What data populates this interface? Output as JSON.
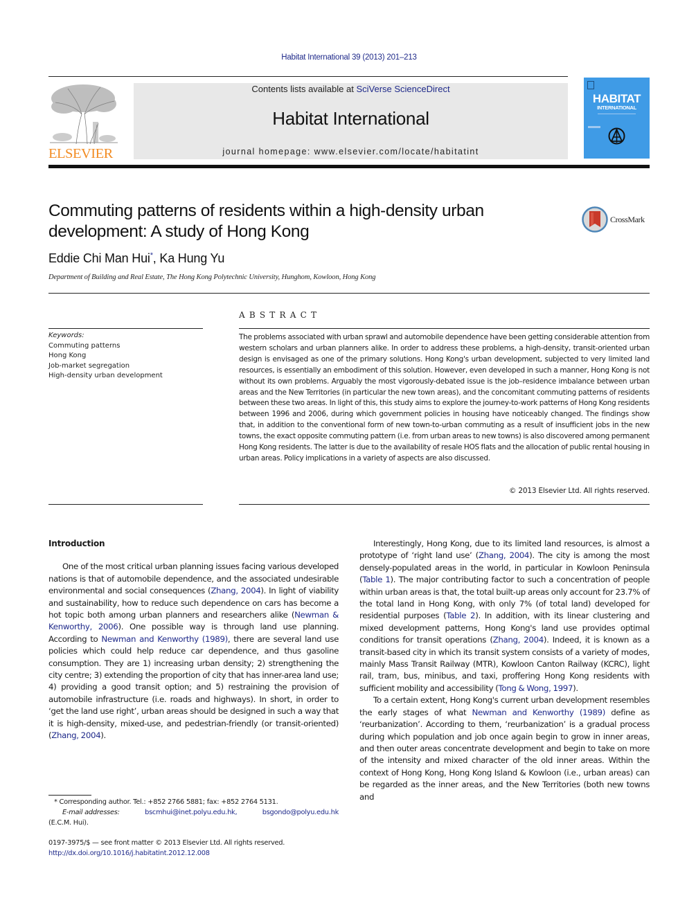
{
  "citation": "Habitat International 39 (2013) 201–213",
  "masthead": {
    "publisher_logo_text": "ELSEVIER",
    "contents_prefix": "Contents lists available at ",
    "contents_link": "SciVerse ScienceDirect",
    "journal_title": "Habitat International",
    "homepage": "journal homepage: www.elsevier.com/locate/habitatint",
    "cover_title": "HABITAT",
    "cover_subtitle": "INTERNATIONAL",
    "cover_color": "#3f9be6",
    "publisher_color": "#f28c23"
  },
  "article": {
    "title": "Commuting patterns of residents within a high-density urban development: A study of Hong Kong",
    "crossmark_label": "CrossMark",
    "authors": [
      {
        "name": "Eddie Chi Man Hui",
        "mark": "*"
      },
      {
        "name": "Ka Hung Yu",
        "mark": ""
      }
    ],
    "author_separator": ", ",
    "affiliation": "Department of Building and Real Estate, The Hong Kong Polytechnic University, Hunghom, Kowloon, Hong Kong"
  },
  "keywords": {
    "label": "Keywords:",
    "items": [
      "Commuting patterns",
      "Hong Kong",
      "Job-market segregation",
      "High-density urban development"
    ]
  },
  "abstract": {
    "heading": "ABSTRACT",
    "text": "The problems associated with urban sprawl and automobile dependence have been getting considerable attention from western scholars and urban planners alike. In order to address these problems, a high-density, transit-oriented urban design is envisaged as one of the primary solutions. Hong Kong's urban development, subjected to very limited land resources, is essentially an embodiment of this solution. However, even developed in such a manner, Hong Kong is not without its own problems. Arguably the most vigorously-debated issue is the job–residence imbalance between urban areas and the New Territories (in particular the new town areas), and the concomitant commuting patterns of residents between these two areas. In light of this, this study aims to explore the journey-to-work patterns of Hong Kong residents between 1996 and 2006, during which government policies in housing have noticeably changed. The findings show that, in addition to the conventional form of new town-to-urban commuting as a result of insufficient jobs in the new towns, the exact opposite commuting pattern (i.e. from urban areas to new towns) is also discovered among permanent Hong Kong residents. The latter is due to the availability of resale HOS flats and the allocation of public rental housing in urban areas. Policy implications in a variety of aspects are also discussed.",
    "copyright": "© 2013 Elsevier Ltd. All rights reserved."
  },
  "body": {
    "section_heading": "Introduction",
    "left_paragraph": [
      {
        "t": "One of the most critical urban planning issues facing various developed nations is that of automobile dependence, and the associated undesirable environmental and social consequences ("
      },
      {
        "t": "Zhang, 2004",
        "link": true
      },
      {
        "t": "). In light of viability and sustainability, how to reduce such dependence on cars has become a hot topic both among urban planners and researchers alike ("
      },
      {
        "t": "Newman & Kenworthy, 2006",
        "link": true
      },
      {
        "t": "). One possible way is through land use planning. According to "
      },
      {
        "t": "Newman and Kenworthy (1989)",
        "link": true
      },
      {
        "t": ", there are several land use policies which could help reduce car dependence, and thus gasoline consumption. They are 1) increasing urban density; 2) strengthening the city centre; 3) extending the proportion of city that has inner-area land use; 4) providing a good transit option; and 5) restraining the provision of automobile infrastructure (i.e. roads and highways). In short, in order to ‘get the land use right’, urban areas should be designed in such a way that it is high-density, mixed-use, and pedestrian-friendly (or transit-oriented) ("
      },
      {
        "t": "Zhang, 2004",
        "link": true
      },
      {
        "t": ")."
      }
    ],
    "right_paragraph_1": [
      {
        "t": "Interestingly, Hong Kong, due to its limited land resources, is almost a prototype of ‘right land use’ ("
      },
      {
        "t": "Zhang, 2004",
        "link": true
      },
      {
        "t": "). The city is among the most densely-populated areas in the world, in particular in Kowloon Peninsula ("
      },
      {
        "t": "Table 1",
        "link": true
      },
      {
        "t": "). The major contributing factor to such a concentration of people within urban areas is that, the total built-up areas only account for 23.7% of the total land in Hong Kong, with only 7% (of total land) developed for residential purposes ("
      },
      {
        "t": "Table 2",
        "link": true
      },
      {
        "t": "). In addition, with its linear clustering and mixed development patterns, Hong Kong's land use provides optimal conditions for transit operations ("
      },
      {
        "t": "Zhang, 2004",
        "link": true
      },
      {
        "t": "). Indeed, it is known as a transit-based city in which its transit system consists of a variety of modes, mainly Mass Transit Railway (MTR), Kowloon Canton Railway (KCRC), light rail, tram, bus, minibus, and taxi, proffering Hong Kong residents with sufficient mobility and accessibility ("
      },
      {
        "t": "Tong & Wong, 1997",
        "link": true
      },
      {
        "t": ")."
      }
    ],
    "right_paragraph_2": [
      {
        "t": "To a certain extent, Hong Kong's current urban development resembles the early stages of what "
      },
      {
        "t": "Newman and Kenworthy (1989)",
        "link": true
      },
      {
        "t": " define as ‘reurbanization’. According to them, ‘reurbanization’ is a gradual process during which population and job once again begin to grow in inner areas, and then outer areas concentrate development and begin to take on more of the intensity and mixed character of the old inner areas. Within the context of Hong Kong, Hong Kong Island & Kowloon (i.e., urban areas) can be regarded as the inner areas, and the New Territories (both new towns and"
      }
    ]
  },
  "footnote": {
    "mark": "*",
    "corresponding": "Corresponding author. Tel.: +852 2766 5881; fax: +852 2764 5131.",
    "email_label": "E-mail addresses:",
    "emails": [
      "bscmhui@inet.polyu.edu.hk,",
      "bsgondo@polyu.edu.hk"
    ],
    "email_owner": "(E.C.M. Hui)."
  },
  "front_matter": {
    "issn_line": "0197-3975/$ — see front matter © 2013 Elsevier Ltd. All rights reserved.",
    "doi": "http://dx.doi.org/10.1016/j.habitatint.2012.12.008"
  }
}
